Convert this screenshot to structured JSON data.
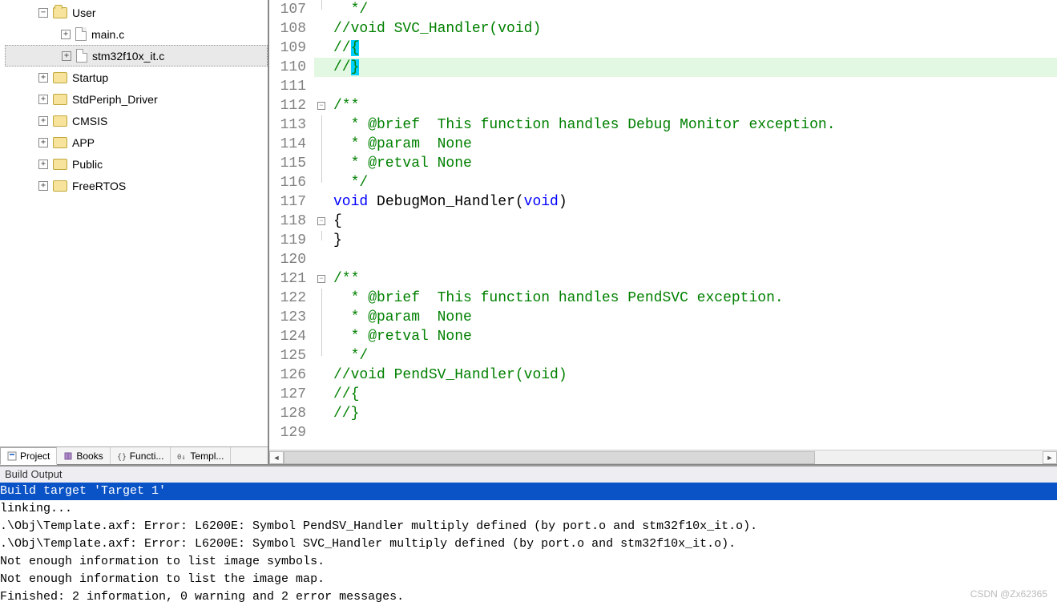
{
  "tree": {
    "root": {
      "label": "User",
      "open": true
    },
    "files": [
      {
        "label": "main.c"
      },
      {
        "label": "stm32f10x_it.c",
        "selected": true
      }
    ],
    "folders": [
      {
        "label": "Startup"
      },
      {
        "label": "StdPeriph_Driver"
      },
      {
        "label": "CMSIS"
      },
      {
        "label": "APP"
      },
      {
        "label": "Public"
      },
      {
        "label": "FreeRTOS"
      }
    ]
  },
  "bottom_tabs": [
    {
      "label": "Project",
      "active": true
    },
    {
      "label": "Books"
    },
    {
      "label": "Functi..."
    },
    {
      "label": "Templ..."
    }
  ],
  "code": [
    {
      "n": 107,
      "fold": "end",
      "seg": [
        {
          "t": "  */",
          "c": "c-green"
        }
      ]
    },
    {
      "n": 108,
      "fold": "",
      "seg": [
        {
          "t": "//void SVC_Handler(void)",
          "c": "c-green"
        }
      ]
    },
    {
      "n": 109,
      "fold": "",
      "seg": [
        {
          "t": "//",
          "c": "c-green"
        },
        {
          "t": "{",
          "c": "c-green",
          "mark": true
        }
      ]
    },
    {
      "n": 110,
      "fold": "",
      "hl": true,
      "seg": [
        {
          "t": "//",
          "c": "c-green"
        },
        {
          "t": "}",
          "c": "c-green",
          "mark": true
        }
      ]
    },
    {
      "n": 111,
      "fold": "",
      "seg": [
        {
          "t": "",
          "c": "c-black"
        }
      ]
    },
    {
      "n": 112,
      "fold": "open",
      "seg": [
        {
          "t": "/**",
          "c": "c-green"
        }
      ]
    },
    {
      "n": 113,
      "fold": "line",
      "seg": [
        {
          "t": "  * @brief  This function handles Debug Monitor exception.",
          "c": "c-green"
        }
      ]
    },
    {
      "n": 114,
      "fold": "line",
      "seg": [
        {
          "t": "  * @param  None",
          "c": "c-green"
        }
      ]
    },
    {
      "n": 115,
      "fold": "line",
      "seg": [
        {
          "t": "  * @retval None",
          "c": "c-green"
        }
      ]
    },
    {
      "n": 116,
      "fold": "end",
      "seg": [
        {
          "t": "  */",
          "c": "c-green"
        }
      ]
    },
    {
      "n": 117,
      "fold": "",
      "seg": [
        {
          "t": "void",
          "c": "c-blue"
        },
        {
          "t": " DebugMon_Handler(",
          "c": "c-black"
        },
        {
          "t": "void",
          "c": "c-blue"
        },
        {
          "t": ")",
          "c": "c-black"
        }
      ]
    },
    {
      "n": 118,
      "fold": "open",
      "seg": [
        {
          "t": "{",
          "c": "c-black"
        }
      ]
    },
    {
      "n": 119,
      "fold": "end",
      "seg": [
        {
          "t": "}",
          "c": "c-black"
        }
      ]
    },
    {
      "n": 120,
      "fold": "",
      "seg": [
        {
          "t": "",
          "c": "c-black"
        }
      ]
    },
    {
      "n": 121,
      "fold": "open",
      "seg": [
        {
          "t": "/**",
          "c": "c-green"
        }
      ]
    },
    {
      "n": 122,
      "fold": "line",
      "seg": [
        {
          "t": "  * @brief  This function handles PendSVC exception.",
          "c": "c-green"
        }
      ]
    },
    {
      "n": 123,
      "fold": "line",
      "seg": [
        {
          "t": "  * @param  None",
          "c": "c-green"
        }
      ]
    },
    {
      "n": 124,
      "fold": "line",
      "seg": [
        {
          "t": "  * @retval None",
          "c": "c-green"
        }
      ]
    },
    {
      "n": 125,
      "fold": "end",
      "seg": [
        {
          "t": "  */",
          "c": "c-green"
        }
      ]
    },
    {
      "n": 126,
      "fold": "",
      "seg": [
        {
          "t": "//void PendSV_Handler(void)",
          "c": "c-green"
        }
      ]
    },
    {
      "n": 127,
      "fold": "",
      "seg": [
        {
          "t": "//{",
          "c": "c-green"
        }
      ]
    },
    {
      "n": 128,
      "fold": "",
      "seg": [
        {
          "t": "//}",
          "c": "c-green"
        }
      ]
    },
    {
      "n": 129,
      "fold": "",
      "seg": [
        {
          "t": "",
          "c": "c-black"
        }
      ]
    }
  ],
  "build": {
    "title": "Build Output",
    "lines": [
      {
        "t": "Build target 'Target 1'",
        "hl": true
      },
      {
        "t": "linking..."
      },
      {
        "t": ".\\Obj\\Template.axf: Error: L6200E: Symbol PendSV_Handler multiply defined (by port.o and stm32f10x_it.o)."
      },
      {
        "t": ".\\Obj\\Template.axf: Error: L6200E: Symbol SVC_Handler multiply defined (by port.o and stm32f10x_it.o)."
      },
      {
        "t": "Not enough information to list image symbols."
      },
      {
        "t": "Not enough information to list the image map."
      },
      {
        "t": "Finished: 2 information, 0 warning and 2 error messages."
      }
    ]
  },
  "watermark": "CSDN @Zx62365"
}
